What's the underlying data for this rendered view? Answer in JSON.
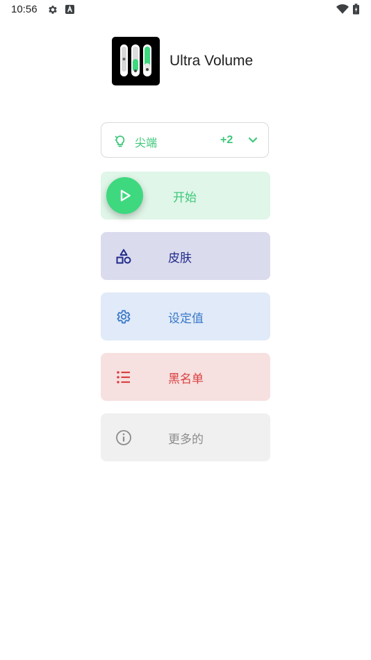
{
  "status_bar": {
    "time": "10:56",
    "icons": [
      "gear-icon",
      "a-notification-icon",
      "wifi-icon",
      "battery-charging-icon"
    ]
  },
  "app": {
    "title": "Ultra Volume",
    "logo_icon": "volume-sliders-logo-icon"
  },
  "profile_selector": {
    "icon": "lightbulb-icon",
    "label": "尖端",
    "extra_count": "+2",
    "expand_icon": "chevron-down-icon"
  },
  "menu": {
    "start": {
      "label": "开始",
      "icon": "play-icon"
    },
    "skins": {
      "label": "皮肤",
      "icon": "shapes-icon"
    },
    "settings": {
      "label": "设定值",
      "icon": "gear-icon"
    },
    "blacklist": {
      "label": "黑名单",
      "icon": "list-icon"
    },
    "more": {
      "label": "更多的",
      "icon": "info-icon"
    }
  },
  "colors": {
    "green": "#3ec77a",
    "fab_green": "#3ed87f",
    "skin_navy": "#1f2a8a",
    "settings_blue": "#3a78c9",
    "blacklist_red": "#d94040",
    "more_gray": "#8c8c8c"
  }
}
